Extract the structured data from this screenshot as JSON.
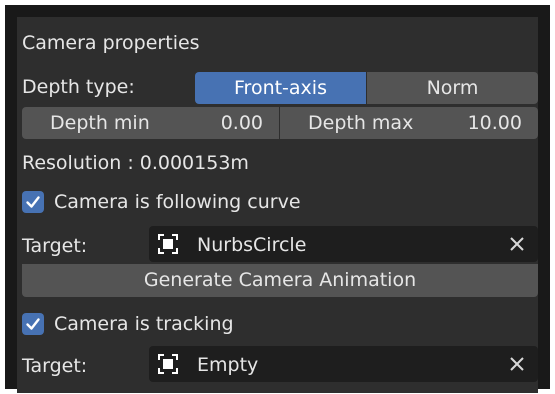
{
  "panel": {
    "title": "Camera properties",
    "depth_type": {
      "label": "Depth type:",
      "options": [
        "Front-axis",
        "Norm"
      ],
      "selected": "Front-axis"
    },
    "depth_min": {
      "label": "Depth min",
      "value": "0.00"
    },
    "depth_max": {
      "label": "Depth max",
      "value": "10.00"
    },
    "resolution_text": "Resolution : 0.000153m",
    "follow_curve": {
      "checked": true,
      "label": "Camera is following curve",
      "target_label": "Target:",
      "target_value": "NurbsCircle",
      "target_icon": "object-icon",
      "clear_icon": "close-icon"
    },
    "generate_button": "Generate Camera Animation",
    "tracking": {
      "checked": true,
      "label": "Camera is tracking",
      "target_label": "Target:",
      "target_value": "Empty",
      "target_icon": "object-icon",
      "clear_icon": "close-icon"
    }
  },
  "colors": {
    "accent": "#4772b3",
    "panel_bg": "#2e2e2e",
    "field_bg": "#545454",
    "object_field_bg": "#1e1e1e"
  }
}
